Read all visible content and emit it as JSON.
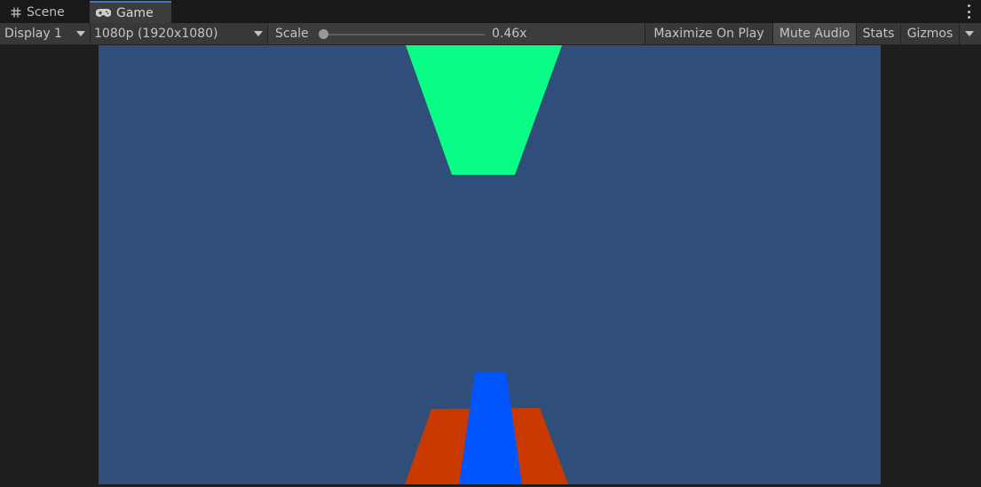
{
  "tabs": [
    {
      "label": "Scene",
      "icon": "grid-icon"
    },
    {
      "label": "Game",
      "icon": "gamepad-icon",
      "active": true
    }
  ],
  "toolbar": {
    "display": "Display 1",
    "resolution": "1080p (1920x1080)",
    "scale_label": "Scale",
    "scale_value": "0.46x",
    "maximize": "Maximize On Play",
    "mute": "Mute Audio",
    "stats": "Stats",
    "gizmos": "Gizmos"
  },
  "colors": {
    "accent": "#3a79bb",
    "viewport_bg": "#2f4e79",
    "green_shape": "#0afd86",
    "orange_shape": "#ca3a00",
    "blue_shape": "#0055ff"
  }
}
